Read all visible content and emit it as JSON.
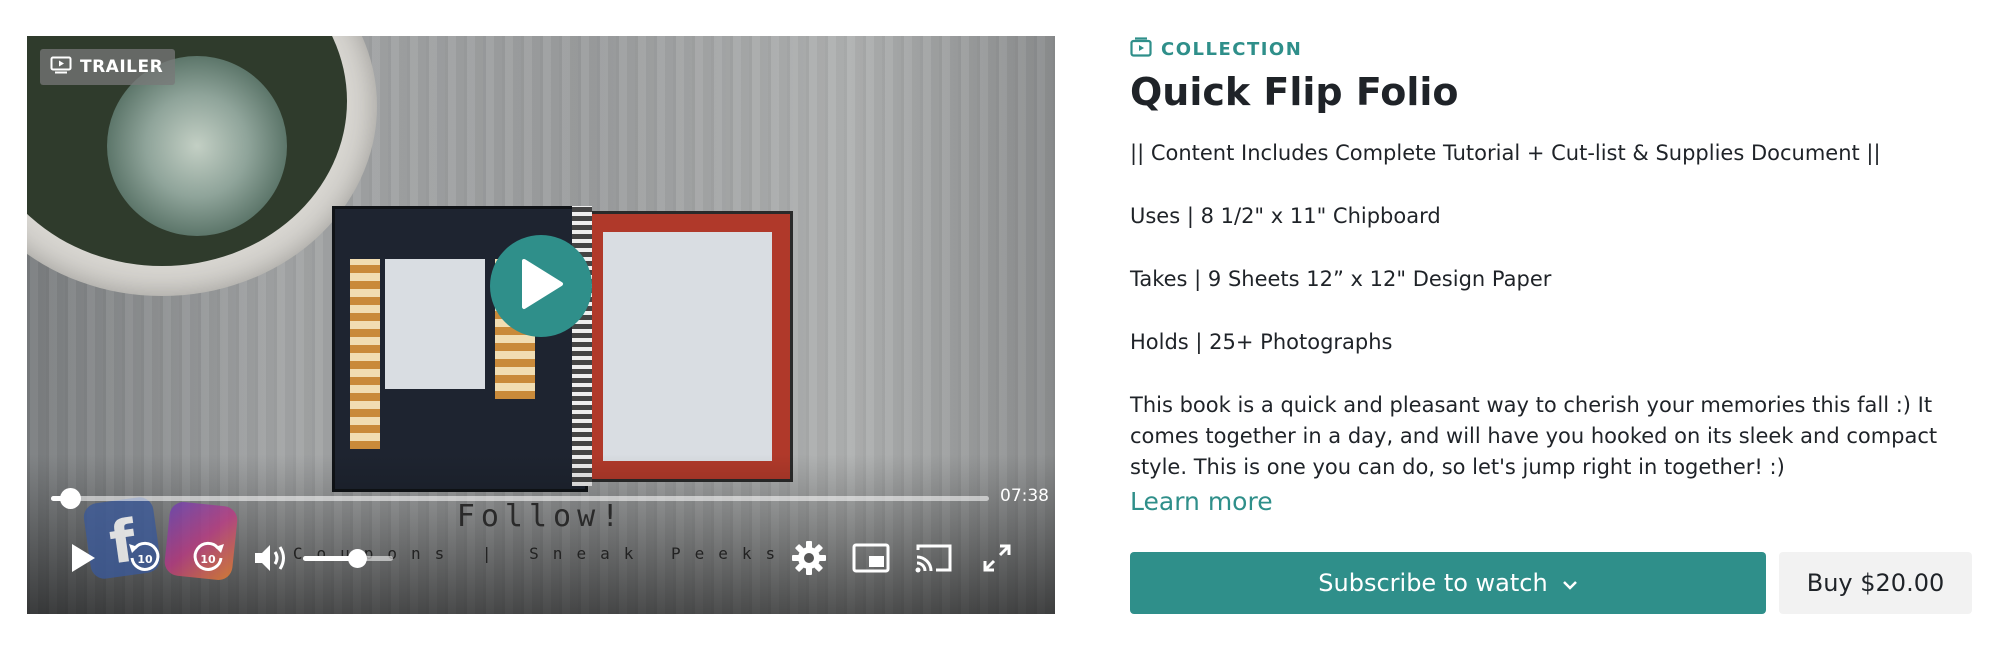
{
  "player": {
    "badge": "TRAILER",
    "duration": "07:38",
    "progress": 0.02,
    "volume": 0.6,
    "overlay_title": "Follow!",
    "overlay_subtitle": "Coupons | Sneak Peeks",
    "accent_color": "#2f8f8a"
  },
  "info": {
    "eyebrow": "COLLECTION",
    "title": "Quick Flip Folio",
    "paragraphs": [
      "|| Content Includes Complete Tutorial + Cut-list & Supplies Document ||",
      "Uses | 8 1/2\" x 11\" Chipboard",
      "Takes | 9 Sheets 12” x 12\" Design Paper",
      "Holds | 25+ Photographs",
      "This book is a quick and pleasant way to cherish your memories this fall :) It comes together in a day, and will have you hooked on its sleek and compact style. This is one you can do, so let's jump right in together! :)"
    ],
    "learn_more": "Learn more",
    "subscribe_label": "Subscribe to watch",
    "buy_label": "Buy $20.00"
  }
}
